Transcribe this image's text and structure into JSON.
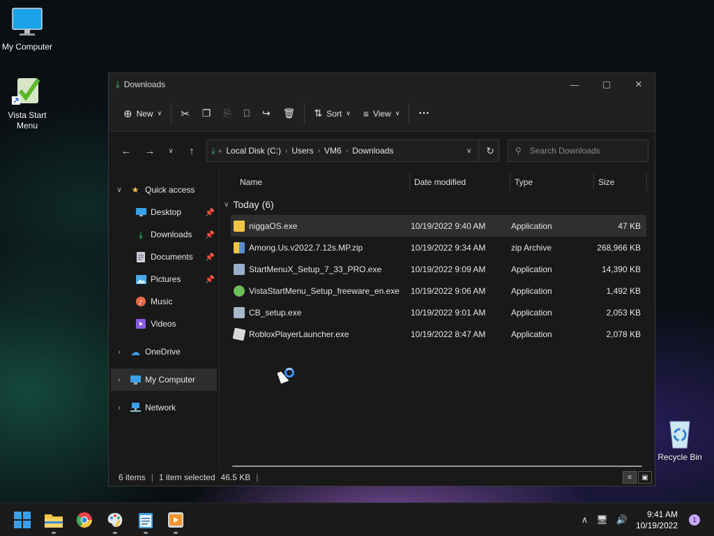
{
  "desktop": {
    "icons": [
      {
        "label": "My Computer"
      },
      {
        "label": "Vista Start Menu"
      },
      {
        "label": "Recycle Bin"
      }
    ]
  },
  "window": {
    "title": "Downloads",
    "toolbar": {
      "new_label": "New",
      "sort_label": "Sort",
      "view_label": "View",
      "more_label": "···"
    },
    "address": {
      "crumbs": [
        "Local Disk (C:)",
        "Users",
        "VM6",
        "Downloads"
      ]
    },
    "search": {
      "placeholder": "Search Downloads"
    },
    "nav": {
      "quick_access": "Quick access",
      "items": [
        {
          "label": "Desktop"
        },
        {
          "label": "Downloads"
        },
        {
          "label": "Documents"
        },
        {
          "label": "Pictures"
        },
        {
          "label": "Music"
        },
        {
          "label": "Videos"
        }
      ],
      "onedrive": "OneDrive",
      "my_computer": "My Computer",
      "network": "Network"
    },
    "columns": {
      "name": "Name",
      "date": "Date modified",
      "type": "Type",
      "size": "Size"
    },
    "group_label": "Today (6)",
    "files": [
      {
        "name": "niggaOS.exe",
        "date": "10/19/2022 9:40 AM",
        "type": "Application",
        "size": "47 KB"
      },
      {
        "name": "Among.Us.v2022.7.12s.MP.zip",
        "date": "10/19/2022 9:34 AM",
        "type": "zip Archive",
        "size": "268,966 KB"
      },
      {
        "name": "StartMenuX_Setup_7_33_PRO.exe",
        "date": "10/19/2022 9:09 AM",
        "type": "Application",
        "size": "14,390 KB"
      },
      {
        "name": "VistaStartMenu_Setup_freeware_en.exe",
        "date": "10/19/2022 9:06 AM",
        "type": "Application",
        "size": "1,492 KB"
      },
      {
        "name": "CB_setup.exe",
        "date": "10/19/2022 9:01 AM",
        "type": "Application",
        "size": "2,053 KB"
      },
      {
        "name": "RobloxPlayerLauncher.exe",
        "date": "10/19/2022 8:47 AM",
        "type": "Application",
        "size": "2,078 KB"
      }
    ],
    "status": {
      "items": "6 items",
      "selected": "1 item selected",
      "size": "46.5 KB"
    }
  },
  "taskbar": {
    "time": "9:41 AM",
    "date": "10/19/2022",
    "notifications": "1"
  },
  "colors": {
    "accent": "#3c8fff",
    "download_green": "#3cc37a",
    "folder_yellow": "#f4c542"
  }
}
